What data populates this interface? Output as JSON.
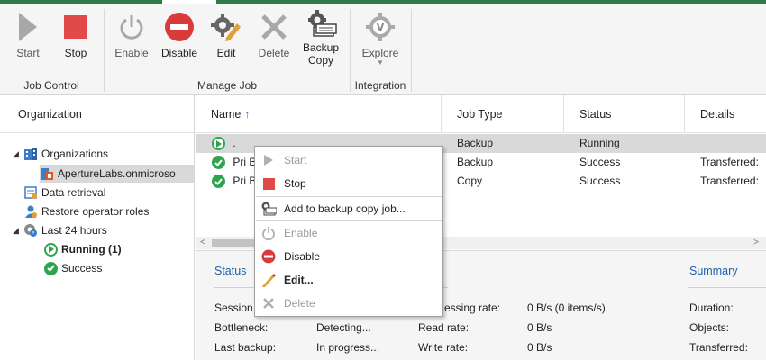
{
  "ribbon": {
    "start": "Start",
    "stop": "Stop",
    "enable": "Enable",
    "disable": "Disable",
    "edit": "Edit",
    "delete": "Delete",
    "backup_copy_line1": "Backup",
    "backup_copy_line2": "Copy",
    "explore": "Explore",
    "groups": {
      "job_control": "Job Control",
      "manage_job": "Manage Job",
      "integration": "Integration"
    }
  },
  "left": {
    "header": "Organization",
    "tree": {
      "organizations": "Organizations",
      "aperture": "ApertureLabs.onmicroso",
      "data_retrieval": "Data retrieval",
      "restore_roles": "Restore operator roles",
      "last24": "Last 24 hours",
      "running": "Running (1)",
      "success": "Success"
    }
  },
  "grid": {
    "columns": [
      "Name",
      "Job Type",
      "Status",
      "Details"
    ],
    "rows": [
      {
        "name": ".",
        "type": "Backup",
        "status": "Running",
        "details": ""
      },
      {
        "name": "Pri B",
        "type": "Backup",
        "status": "Success",
        "details": "Transferred:"
      },
      {
        "name": "Pri B",
        "type": "Copy",
        "status": "Success",
        "details": "Transferred:"
      }
    ]
  },
  "details": {
    "status_header": "Status",
    "summary_header": "Summary",
    "session_label": "Session",
    "bottleneck_label": "Bottleneck:",
    "bottleneck_value": "Detecting...",
    "last_backup_label": "Last backup:",
    "last_backup_value": "In progress...",
    "processing_rate_label": "essing rate:",
    "processing_rate_value": "0 B/s (0 items/s)",
    "read_rate_label": "Read rate:",
    "read_rate_value": "0 B/s",
    "write_rate_label": "Write rate:",
    "write_rate_value": "0 B/s",
    "duration_label": "Duration:",
    "objects_label": "Objects:",
    "transferred_label": "Transferred:"
  },
  "context_menu": {
    "start": "Start",
    "stop": "Stop",
    "add_backup_copy": "Add to backup copy job...",
    "enable": "Enable",
    "disable": "Disable",
    "edit": "Edit...",
    "delete": "Delete"
  },
  "colors": {
    "accent_green": "#2ea44f",
    "stop_red": "#e24a4a",
    "disable_red": "#d93a3a",
    "link_blue": "#1f5fa8"
  }
}
